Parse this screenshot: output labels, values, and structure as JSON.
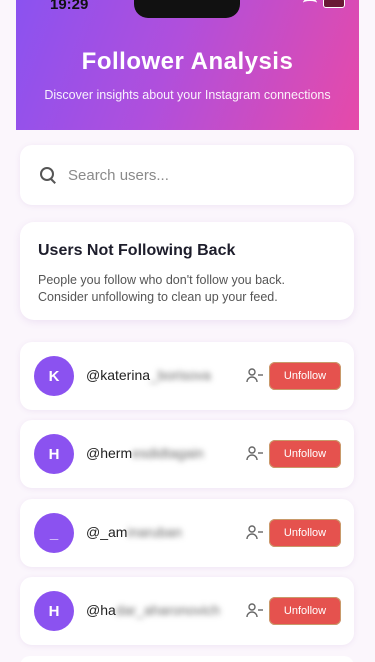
{
  "status_bar": {
    "time": "19:29"
  },
  "header": {
    "title": "Follower Analysis",
    "subtitle": "Discover insights about your Instagram connections"
  },
  "search": {
    "placeholder": "Search users..."
  },
  "info": {
    "title": "Users Not Following Back",
    "description": "People you follow who don't follow you back. Consider unfollowing to clean up your feed."
  },
  "users": [
    {
      "initial": "K",
      "handle_visible": "@katerina",
      "handle_blurred": "_borisova",
      "button": "Unfollow"
    },
    {
      "initial": "H",
      "handle_visible": "@herm",
      "handle_blurred": "esdidtagain",
      "button": "Unfollow"
    },
    {
      "initial": "_",
      "handle_visible": "@_am",
      "handle_blurred": "inaruban",
      "button": "Unfollow"
    },
    {
      "initial": "H",
      "handle_visible": "@ha",
      "handle_blurred": "dar_aharonovich",
      "button": "Unfollow"
    }
  ],
  "colors": {
    "accent": "#8b52f0",
    "gradient_end": "#e64aa9",
    "unfollow": "#e5524e"
  }
}
